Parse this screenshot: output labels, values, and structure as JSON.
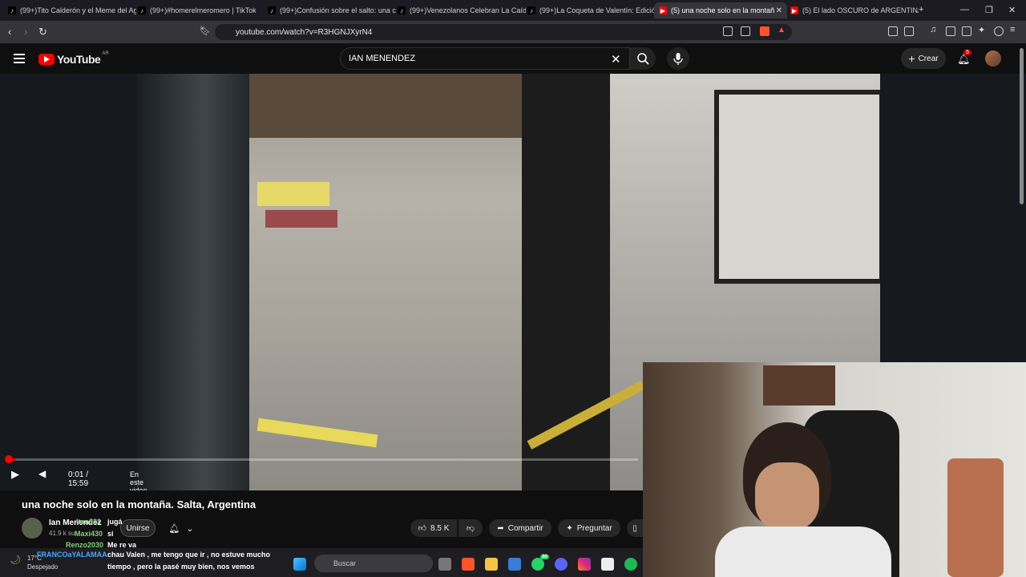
{
  "browser": {
    "tabs": [
      {
        "title": "(99+)Tito Calderón y el Meme del Ag",
        "favicon": "tiktok"
      },
      {
        "title": "(99+)#homerelmeromero | TikTok",
        "favicon": "tiktok"
      },
      {
        "title": "(99+)Confusión sobre el salto: una c",
        "favicon": "tiktok"
      },
      {
        "title": "(99+)Venezolanos Celebran La Caída",
        "favicon": "tiktok"
      },
      {
        "title": "(99+)La Coqueta de Valentín: Edición",
        "favicon": "tiktok"
      },
      {
        "title": "(5) una noche solo en la montañ",
        "favicon": "youtube",
        "active": true
      },
      {
        "title": "(5) El lado OSCURO de ARGENTINA",
        "favicon": "youtube"
      }
    ],
    "url": "youtube.com/watch?v=R3HGNJXyrN4"
  },
  "youtube": {
    "logo_text": "YouTube",
    "country": "AR",
    "search_value": "IAN MENENDEZ",
    "create_label": "Crear",
    "notif_count": "5"
  },
  "player": {
    "time": "0:01 / 15:59",
    "chapter_label": "En este video",
    "progress": 0.001
  },
  "video": {
    "title": "una noche solo en la montaña. Salta, Argentina",
    "channel": "Ian Menendez",
    "subs": "41.9 k su",
    "join_label": "Unirse",
    "likes": "8.5 K",
    "share_label": "Compartir",
    "ask_label": "Preguntar"
  },
  "chat": [
    {
      "user": "Itan322",
      "msg": "jugá",
      "color": "#7fd37a"
    },
    {
      "user": "Maxi430",
      "msg": "si",
      "color": "#7fd37a"
    },
    {
      "user": "Renzo2030",
      "msg": "Me re va",
      "color": "#7fd37a"
    },
    {
      "user": "FRANCOaYALAMAA",
      "msg": "chau Valen , me tengo que ir , no estuve mucho",
      "color": "#4aa8ff"
    },
    {
      "user": "",
      "msg": "tiempo , pero la pasé muy bien, nos vemos",
      "color": "#4aa8ff"
    }
  ],
  "taskbar": {
    "temp": "17°C",
    "weather": "Despejado",
    "search_placeholder": "Buscar",
    "whatsapp_badge": "30"
  }
}
